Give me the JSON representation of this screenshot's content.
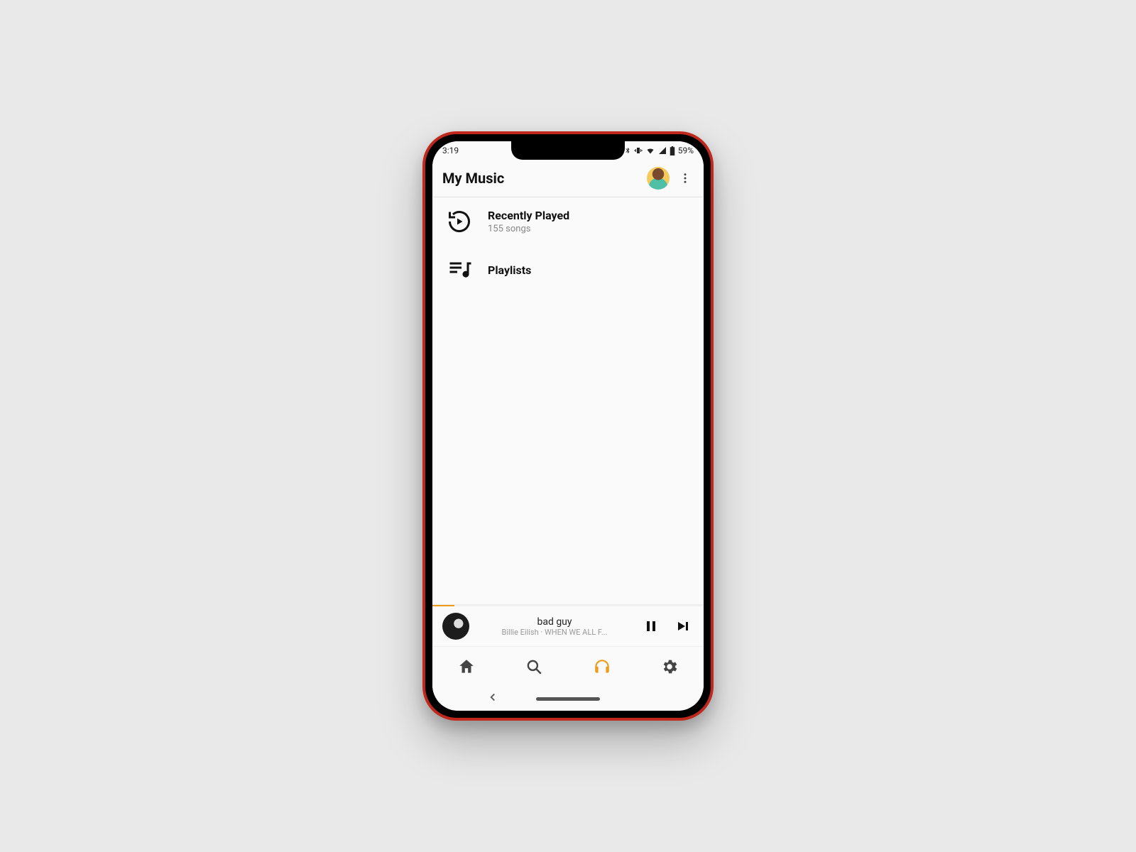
{
  "status": {
    "time": "3:19",
    "battery": "59%"
  },
  "appbar": {
    "title": "My Music"
  },
  "list": {
    "recent": {
      "title": "Recently Played",
      "subtitle": "155 songs"
    },
    "playlists": {
      "title": "Playlists"
    }
  },
  "player": {
    "track": "bad guy",
    "artist_album": "Billie Eilish · WHEN WE ALL F...",
    "progress_pct": "8%"
  },
  "accent": "#f09a1a"
}
